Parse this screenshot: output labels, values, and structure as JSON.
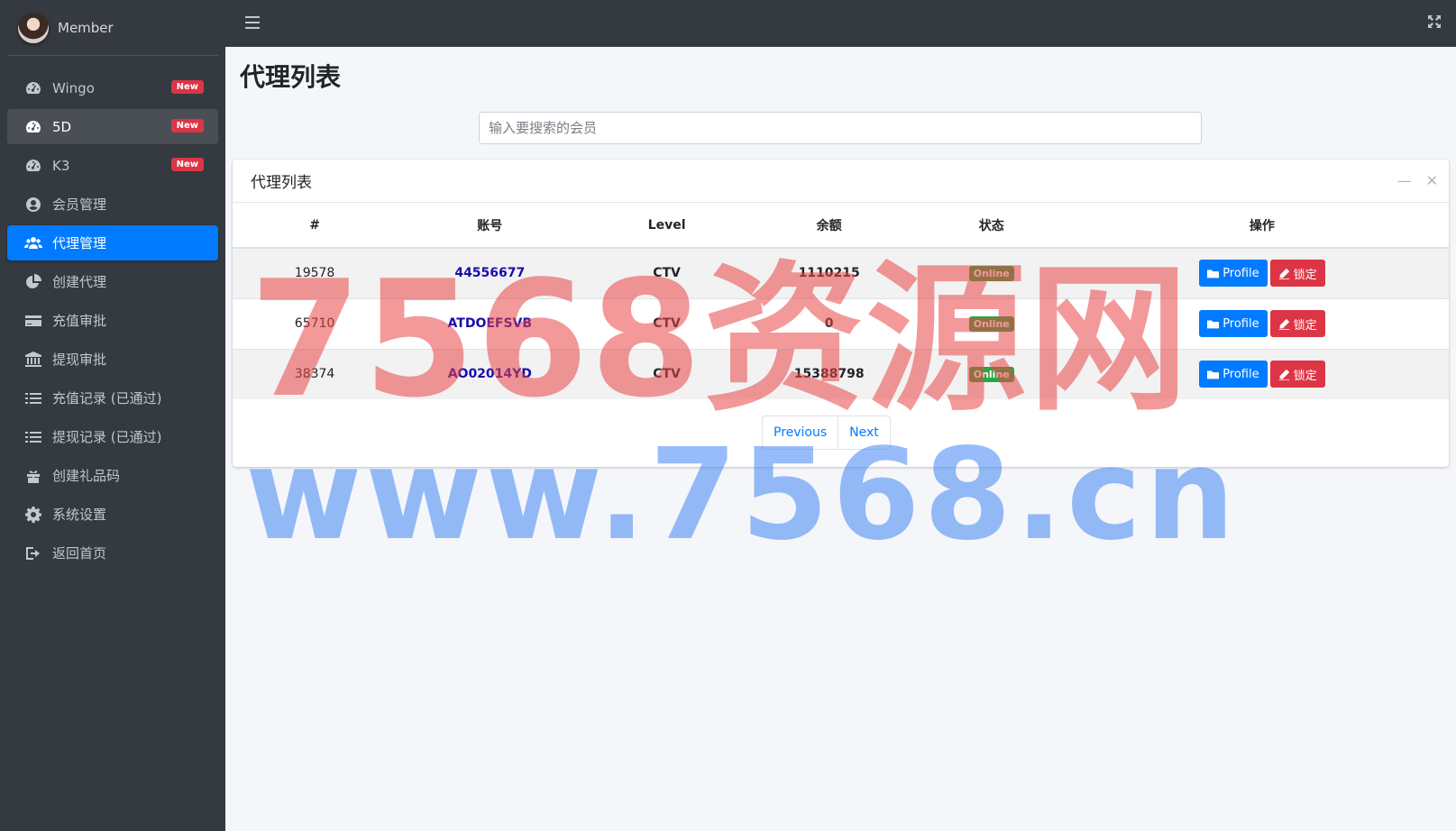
{
  "brand": {
    "name": "Member"
  },
  "sidebar": {
    "items": [
      {
        "label": "Wingo",
        "icon": "dashboard-icon",
        "badge": "New"
      },
      {
        "label": "5D",
        "icon": "dashboard-icon",
        "badge": "New"
      },
      {
        "label": "K3",
        "icon": "dashboard-icon",
        "badge": "New"
      },
      {
        "label": "会员管理",
        "icon": "user-circle-icon"
      },
      {
        "label": "代理管理",
        "icon": "users-icon"
      },
      {
        "label": "创建代理",
        "icon": "pie-chart-icon"
      },
      {
        "label": "充值审批",
        "icon": "credit-card-icon"
      },
      {
        "label": "提现审批",
        "icon": "bank-icon"
      },
      {
        "label": "充值记录 (已通过)",
        "icon": "list-icon"
      },
      {
        "label": "提现记录 (已通过)",
        "icon": "list-icon"
      },
      {
        "label": "创建礼品码",
        "icon": "gift-icon"
      },
      {
        "label": "系统设置",
        "icon": "gear-icon"
      },
      {
        "label": "返回首页",
        "icon": "sign-out-icon"
      }
    ]
  },
  "page": {
    "title": "代理列表"
  },
  "search": {
    "placeholder": "输入要搜索的会员"
  },
  "card": {
    "title": "代理列表"
  },
  "table": {
    "headers": [
      "#",
      "账号",
      "Level",
      "余额",
      "状态",
      "操作"
    ],
    "rows": [
      {
        "id": "19578",
        "account": "44556677",
        "level": "CTV",
        "balance": "1110215",
        "status": "Online"
      },
      {
        "id": "65710",
        "account": "ATDOEFSVB",
        "level": "CTV",
        "balance": "0",
        "status": "Online"
      },
      {
        "id": "38374",
        "account": "AO02014YD",
        "level": "CTV",
        "balance": "15388798",
        "status": "Online"
      }
    ],
    "actions": {
      "profile": "Profile",
      "lock": "锁定"
    }
  },
  "pagination": {
    "previous": "Previous",
    "next": "Next"
  },
  "watermark": {
    "line1": "7568资源网",
    "line2": "www.7568.cn"
  },
  "colors": {
    "sidebar": "#343a40",
    "active": "#007bff",
    "danger": "#dc3545",
    "success": "#28a745"
  }
}
